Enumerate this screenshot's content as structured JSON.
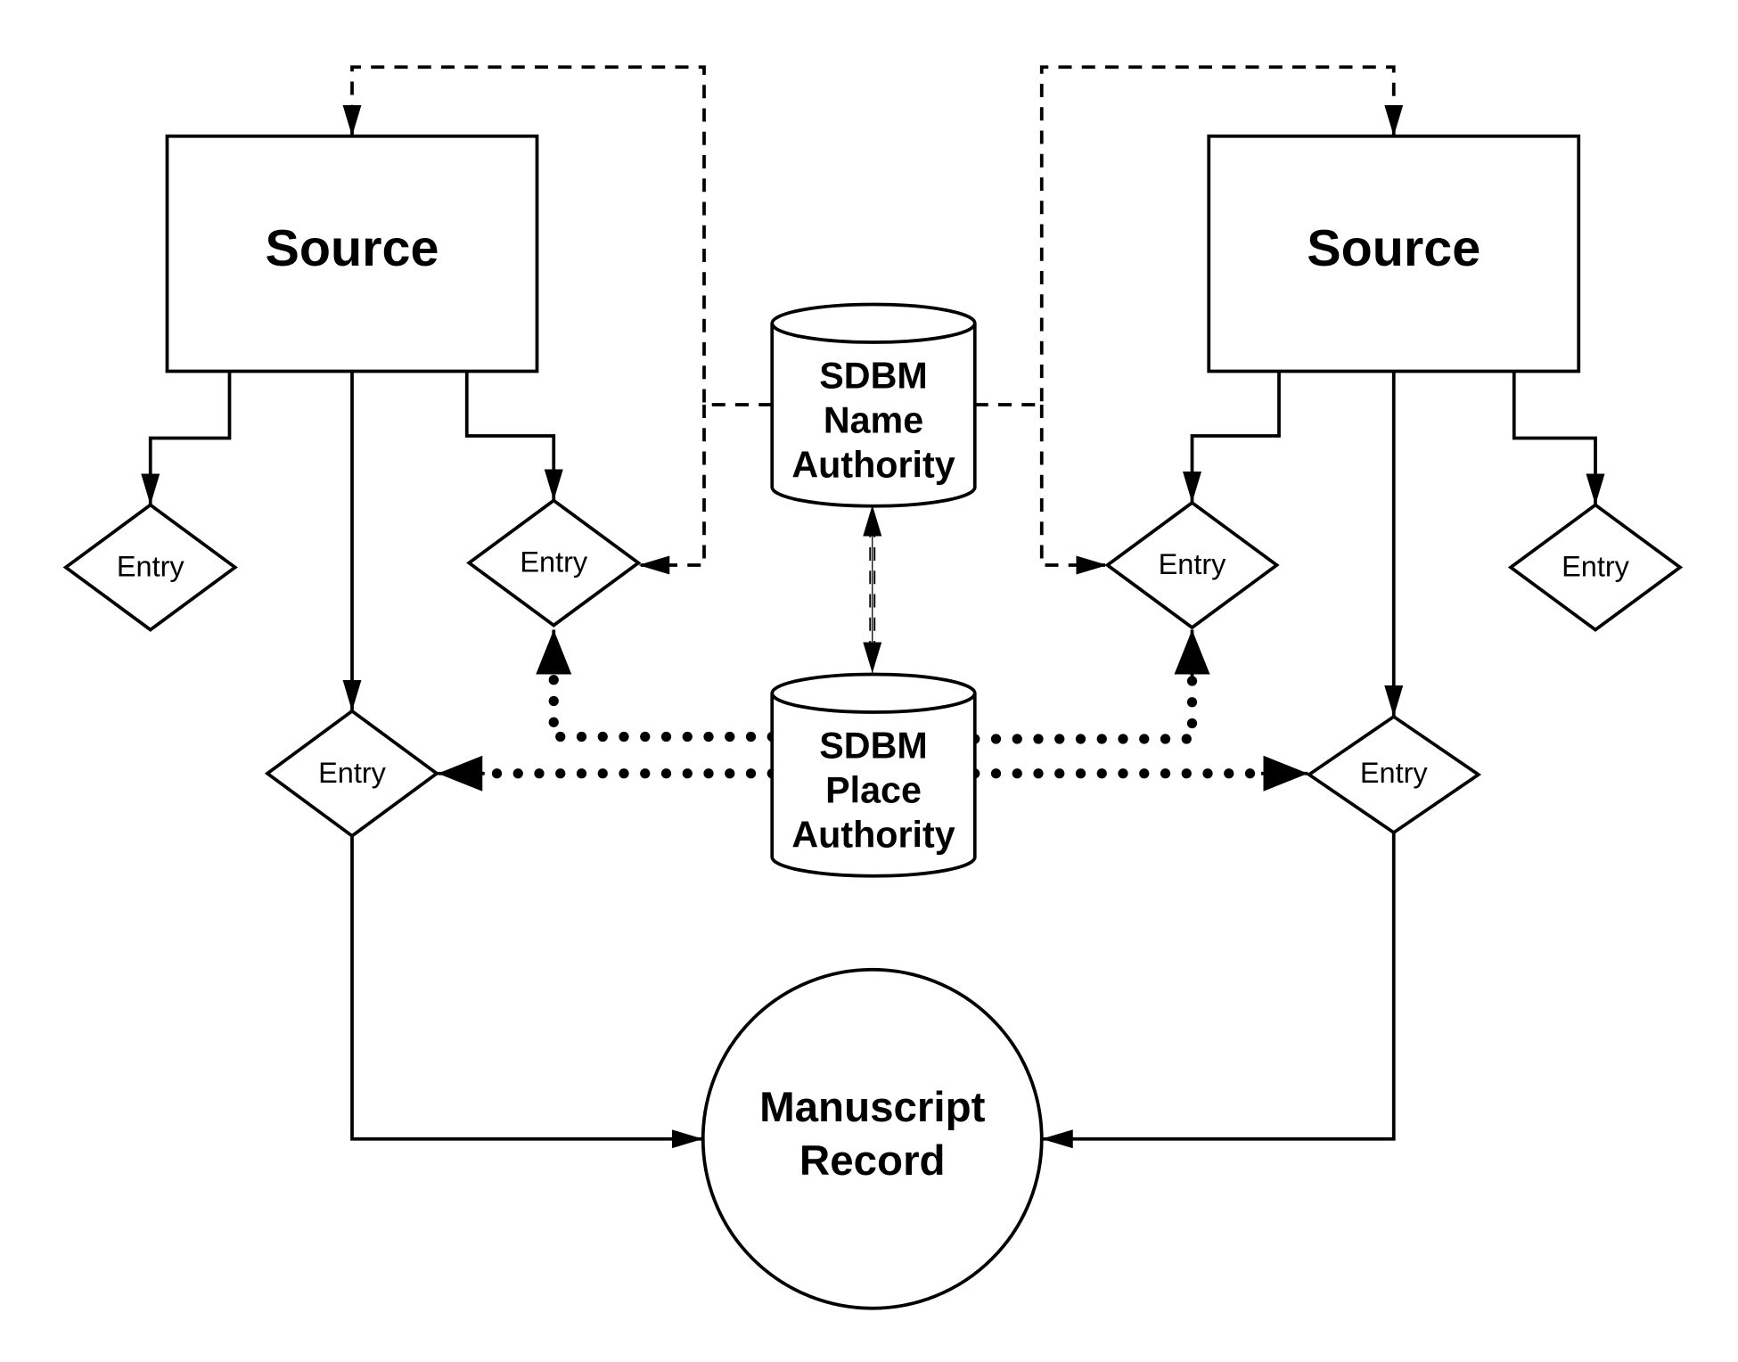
{
  "nodes": {
    "source_left": "Source",
    "source_right": "Source",
    "name_authority": [
      "SDBM",
      "Name",
      "Authority"
    ],
    "place_authority": [
      "SDBM",
      "Place",
      "Authority"
    ],
    "manuscript_record": [
      "Manuscript",
      "Record"
    ],
    "entries": [
      "Entry",
      "Entry",
      "Entry",
      "Entry",
      "Entry",
      "Entry"
    ]
  },
  "edge_styles": {
    "source_to_entry": "solid",
    "name_authority_links": "dashed",
    "place_authority_links": "dotted",
    "authority_to_authority": "double-dashed"
  }
}
